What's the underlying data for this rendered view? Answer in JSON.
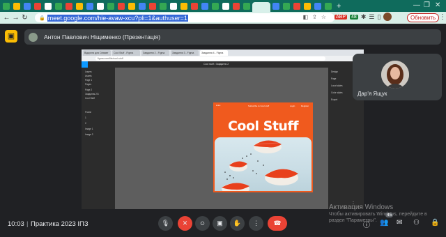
{
  "browser": {
    "url": "meet.google.com/hie-avaw-xcu?pli=1&authuser=1",
    "update_button": "Обновить",
    "extensions": {
      "badge_red": "ABP",
      "badge_green": "48"
    }
  },
  "meet": {
    "presenter_label": "Антон Павлович Ніщименко (Презентація)",
    "participant_name": "Дар'я Ящук",
    "time": "10:03",
    "separator": "|",
    "meeting_name": "Практика 2023 ІПЗ",
    "participant_count": "45"
  },
  "shared_screen": {
    "tabs": [
      "Відкрита для Співавт",
      "Cool Stuff - Figma",
      "Завдання 2 - Figma",
      "Завдання 3 - Figma",
      "Завдання 4 - Figma"
    ],
    "address": "figma.com/file/cool-stuff",
    "file_title": "Cool stuff / Завдання 2",
    "left_panel": [
      "Layers",
      "Assets",
      "Page 1",
      "Pages",
      "Page 2",
      "Завдання 2/3",
      "Cool Stuff",
      "Frame",
      "1",
      "2",
      "Image 1",
      "Image 2"
    ],
    "right_panel": [
      "Design",
      "Page",
      "Local styles",
      "Color styles",
      "Export"
    ],
    "artboard": {
      "logo": "●●●",
      "nav_mid": "Subscribe to Cool stuff",
      "nav_r1": "Login",
      "nav_r2": "Register",
      "title": "Cool Stuff"
    }
  },
  "windows_activation": {
    "title": "Активация Windows",
    "line1": "Чтобы активировать Windows, перейдите в",
    "line2": "раздел \"Параметры\"."
  },
  "colors": {
    "meet_bg": "#202124",
    "tab_strip": "#0f6b5c",
    "artboard_orange": "#f05a1e",
    "hangup_red": "#ea4335"
  }
}
